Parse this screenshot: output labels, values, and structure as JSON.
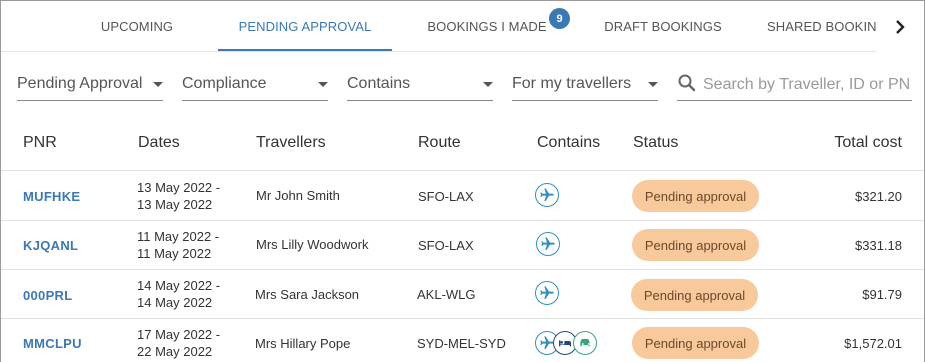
{
  "tabs": [
    {
      "label": "UPCOMING",
      "active": false
    },
    {
      "label": "PENDING APPROVAL",
      "active": true
    },
    {
      "label": "BOOKINGS I MADE",
      "active": false,
      "badge": "9"
    },
    {
      "label": "DRAFT BOOKINGS",
      "active": false
    },
    {
      "label": "SHARED BOOKINGS",
      "active": false
    }
  ],
  "tab_next_icon": "chevron-right-icon",
  "filters": [
    {
      "value": "Pending Approval"
    },
    {
      "value": "Compliance"
    },
    {
      "value": "Contains"
    },
    {
      "value": "For my travellers"
    }
  ],
  "search": {
    "placeholder": "Search by Traveller, ID or PNR",
    "icon": "search-icon"
  },
  "table": {
    "headers": [
      "PNR",
      "Dates",
      "Travellers",
      "Route",
      "Contains",
      "Status",
      "Total cost"
    ],
    "rows": [
      {
        "pnr": "MUFHKE",
        "date_from": "13 May 2022 -",
        "date_to": "13 May 2022",
        "traveller": "Mr John Smith",
        "route": "SFO-LAX",
        "contains": [
          "flight-icon"
        ],
        "status": "Pending approval",
        "cost": "$321.20"
      },
      {
        "pnr": "KJQANL",
        "date_from": "11 May 2022 -",
        "date_to": "11 May 2022",
        "traveller": "Mrs Lilly Woodwork",
        "route": "SFO-LAX",
        "contains": [
          "flight-icon"
        ],
        "status": "Pending approval",
        "cost": "$331.18"
      },
      {
        "pnr": "000PRL",
        "date_from": "14 May 2022 -",
        "date_to": "14 May 2022",
        "traveller": "Mrs Sara Jackson",
        "route": "AKL-WLG",
        "contains": [
          "flight-icon"
        ],
        "status": "Pending approval",
        "cost": "$91.79"
      },
      {
        "pnr": "MMCLPU",
        "date_from": "17 May 2022 -",
        "date_to": "22 May 2022",
        "traveller": "Mrs Hillary Pope",
        "route": "SYD-MEL-SYD",
        "contains": [
          "flight-icon",
          "hotel-icon",
          "car-icon"
        ],
        "status": "Pending approval",
        "cost": "$1,572.01"
      }
    ]
  },
  "colors": {
    "accent": "#3b78b5",
    "status_bg": "#f8c99a",
    "icon_blue": "#2f8fc2",
    "icon_green": "#3aa37a"
  }
}
